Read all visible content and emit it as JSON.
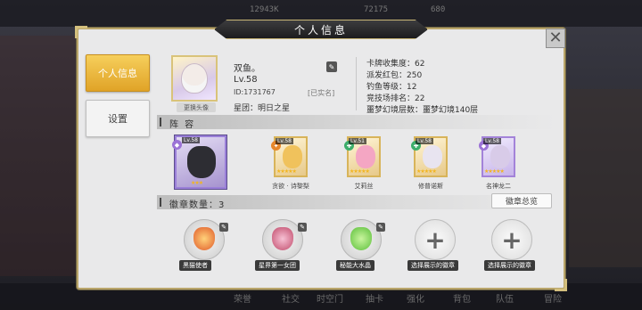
{
  "background": {
    "resources": [
      "12943K",
      "72175",
      "680"
    ],
    "nav": [
      "荣誉",
      "社交",
      "时空门",
      "抽卡",
      "强化",
      "背包",
      "队伍",
      "冒险"
    ]
  },
  "panel": {
    "title": "个人信息",
    "close_icon": "close-icon"
  },
  "tabs": [
    {
      "label": "个人信息",
      "active": true
    },
    {
      "label": "设置",
      "active": false
    }
  ],
  "profile": {
    "change_avatar_label": "更换头像",
    "nickname": "双鱼。",
    "level": "Lv.58",
    "uid": "ID:1731767",
    "realname_status": "[已实名]",
    "guild": "星团：明日之星"
  },
  "stats": [
    "卡牌收集度：62",
    "派发红包：250",
    "钓鱼等级：12",
    "竞技场排名：22",
    "噩梦幻境层数：噩梦幻境140层"
  ],
  "lineup": {
    "title": "阵 容",
    "main": {
      "level": "Lv.58"
    },
    "members": [
      {
        "name": "贪欲 · 诗黎梨",
        "level": "Lv.58",
        "color": "#f0c25c"
      },
      {
        "name": "艾莉丝",
        "level": "Lv.51",
        "color": "#f4a6c3"
      },
      {
        "name": "修普诺斯",
        "level": "Lv.58",
        "color": "#e8e4f0"
      },
      {
        "name": "名神龙二",
        "level": "Lv.58",
        "color": "#d8cbe8"
      }
    ]
  },
  "badges": {
    "title": "徽章数量：3",
    "summary_button": "徽章总览",
    "items": [
      {
        "label": "黑猫使者",
        "color": "#e05a2a"
      },
      {
        "label": "星界第一女团",
        "color": "#c04a6a"
      },
      {
        "label": "秘能大水晶",
        "color": "#5bbf3a"
      },
      {
        "label": "选择展示的徽章",
        "empty": true
      },
      {
        "label": "选择展示的徽章",
        "empty": true
      }
    ]
  }
}
